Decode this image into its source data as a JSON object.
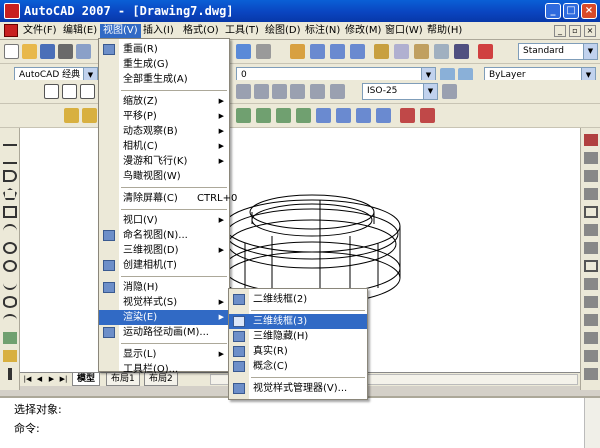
{
  "window": {
    "title": "AutoCAD 2007 - [Drawing7.dwg]",
    "minimize": "_",
    "maximize": "□",
    "close": "×"
  },
  "menubar": {
    "items": [
      "文件(F)",
      "编辑(E)",
      "视图(V)",
      "插入(I)",
      "格式(O)",
      "工具(T)",
      "绘图(D)",
      "标注(N)",
      "修改(M)",
      "窗口(W)",
      "帮助(H)"
    ],
    "active_index": 2
  },
  "toolbar": {
    "text_style": "Standard",
    "workspace": "AutoCAD 经典",
    "layer": "0",
    "linetype": "ByLayer",
    "dim_style": "ISO-25"
  },
  "view_menu": {
    "items": [
      {
        "label": "重画",
        "key": "R",
        "icon": "pencil-icon"
      },
      {
        "label": "重生成",
        "key": "G"
      },
      {
        "label": "全部重生成",
        "key": "A"
      },
      {
        "sep": true
      },
      {
        "label": "缩放",
        "key": "Z",
        "sub": true
      },
      {
        "label": "平移",
        "key": "P",
        "sub": true
      },
      {
        "label": "动态观察",
        "key": "B",
        "sub": true
      },
      {
        "label": "相机",
        "key": "C",
        "sub": true
      },
      {
        "label": "漫游和飞行",
        "key": "K",
        "sub": true
      },
      {
        "label": "鸟瞰视图",
        "key": "W"
      },
      {
        "sep": true
      },
      {
        "label": "清除屏幕",
        "key": "C",
        "shortcut": "CTRL+0"
      },
      {
        "sep": true
      },
      {
        "label": "视口",
        "key": "V",
        "sub": true
      },
      {
        "label": "命名视图",
        "key": "N",
        "suffix": "...",
        "icon": "named-view-icon"
      },
      {
        "label": "三维视图",
        "key": "D",
        "sub": true
      },
      {
        "label": "创建相机",
        "key": "T",
        "icon": "camera-icon"
      },
      {
        "sep": true
      },
      {
        "label": "消隐",
        "key": "H",
        "icon": "hide-icon"
      },
      {
        "label": "视觉样式",
        "key": "S",
        "sub": true
      },
      {
        "label": "渲染",
        "key": "E",
        "sub": true,
        "highlight": true
      },
      {
        "label": "运动路径动画",
        "key": "M",
        "suffix": "...",
        "icon": "motion-path-icon"
      },
      {
        "sep": true
      },
      {
        "label": "显示",
        "key": "L",
        "sub": true
      },
      {
        "label": "工具栏",
        "key": "O",
        "suffix": "..."
      }
    ]
  },
  "visual_styles_menu": {
    "items": [
      {
        "label": "二维线框",
        "key": "2",
        "icon": "2d-wireframe-icon"
      },
      {
        "sep": true
      },
      {
        "label": "三维线框",
        "key": "3",
        "icon": "3d-wireframe-icon",
        "highlight": true
      },
      {
        "label": "三维隐藏",
        "key": "H",
        "icon": "3d-hidden-icon"
      },
      {
        "label": "真实",
        "key": "R",
        "icon": "realistic-icon"
      },
      {
        "label": "概念",
        "key": "C",
        "icon": "conceptual-icon"
      },
      {
        "sep": true
      },
      {
        "label": "视觉样式管理器",
        "key": "V",
        "suffix": "...",
        "icon": "style-manager-icon"
      }
    ]
  },
  "layout_tabs": {
    "items": [
      "模型",
      "布局1",
      "布局2"
    ],
    "active_index": 0
  },
  "command": {
    "history": "选择对象:",
    "prompt": "命令:"
  },
  "colors": {
    "menu_highlight": "#316ac5",
    "titlebar": "#0a45c0"
  }
}
